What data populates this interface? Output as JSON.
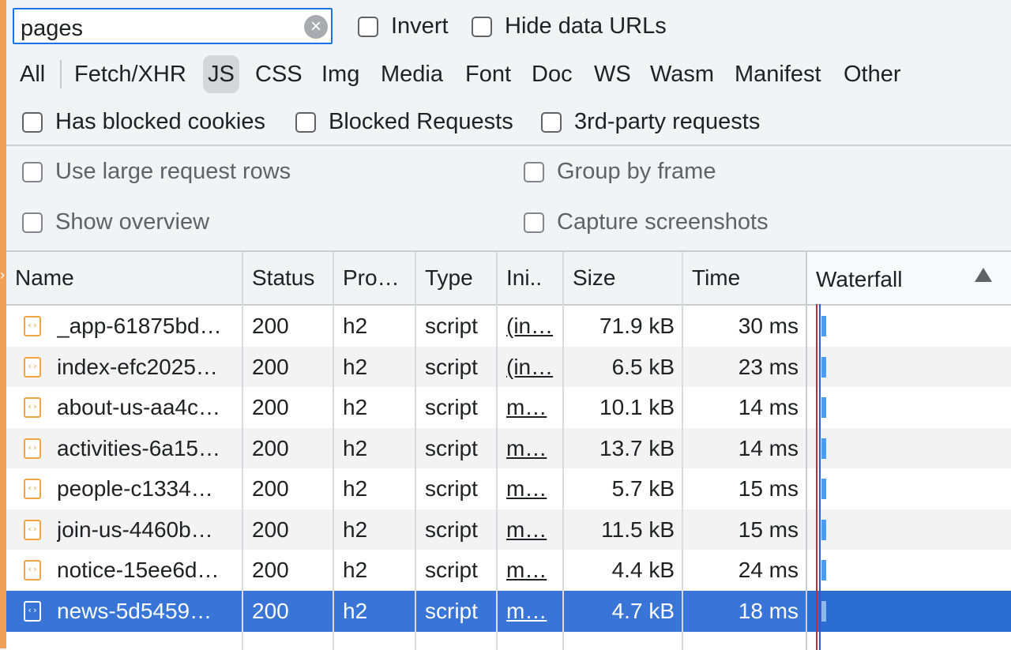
{
  "filter": {
    "search_value": "pages",
    "clear_glyph": "×",
    "invert_label": "Invert",
    "hide_data_urls_label": "Hide data URLs"
  },
  "types": [
    "All",
    "Fetch/XHR",
    "JS",
    "CSS",
    "Img",
    "Media",
    "Font",
    "Doc",
    "WS",
    "Wasm",
    "Manifest",
    "Other"
  ],
  "active_type": "JS",
  "options": {
    "has_blocked_cookies": "Has blocked cookies",
    "blocked_requests": "Blocked Requests",
    "third_party": "3rd-party requests",
    "large_rows": "Use large request rows",
    "group_by_frame": "Group by frame",
    "show_overview": "Show overview",
    "capture_screenshots": "Capture screenshots"
  },
  "table": {
    "headers": {
      "name": "Name",
      "status": "Status",
      "protocol": "Pro…",
      "type": "Type",
      "initiator": "Ini..",
      "size": "Size",
      "time": "Time",
      "waterfall": "Waterfall"
    },
    "rows": [
      {
        "name": "_app-61875bd…",
        "status": "200",
        "protocol": "h2",
        "type": "script",
        "initiator": "(in…",
        "size": "71.9 kB",
        "time": "30 ms"
      },
      {
        "name": "index-efc2025…",
        "status": "200",
        "protocol": "h2",
        "type": "script",
        "initiator": "(in…",
        "size": "6.5 kB",
        "time": "23 ms"
      },
      {
        "name": "about-us-aa4c…",
        "status": "200",
        "protocol": "h2",
        "type": "script",
        "initiator": "m…",
        "size": "10.1 kB",
        "time": "14 ms"
      },
      {
        "name": "activities-6a15…",
        "status": "200",
        "protocol": "h2",
        "type": "script",
        "initiator": "m…",
        "size": "13.7 kB",
        "time": "14 ms"
      },
      {
        "name": "people-c1334…",
        "status": "200",
        "protocol": "h2",
        "type": "script",
        "initiator": "m…",
        "size": "5.7 kB",
        "time": "15 ms"
      },
      {
        "name": "join-us-4460b…",
        "status": "200",
        "protocol": "h2",
        "type": "script",
        "initiator": "m…",
        "size": "11.5 kB",
        "time": "15 ms"
      },
      {
        "name": "notice-15ee6d…",
        "status": "200",
        "protocol": "h2",
        "type": "script",
        "initiator": "m…",
        "size": "4.4 kB",
        "time": "24 ms"
      },
      {
        "name": "news-5d5459…",
        "status": "200",
        "protocol": "h2",
        "type": "script",
        "initiator": "m…",
        "size": "4.7 kB",
        "time": "18 ms"
      }
    ],
    "selected_row": 7
  },
  "icons": {
    "clear": "clear-icon",
    "script_file": "script-file-icon",
    "sort": "sort-ascending-icon"
  },
  "colors": {
    "selected_row": "#3875d7",
    "search_focus": "#1a73e8",
    "file_icon": "#f0a640",
    "waterfall_bar": "#4b9cf0"
  }
}
